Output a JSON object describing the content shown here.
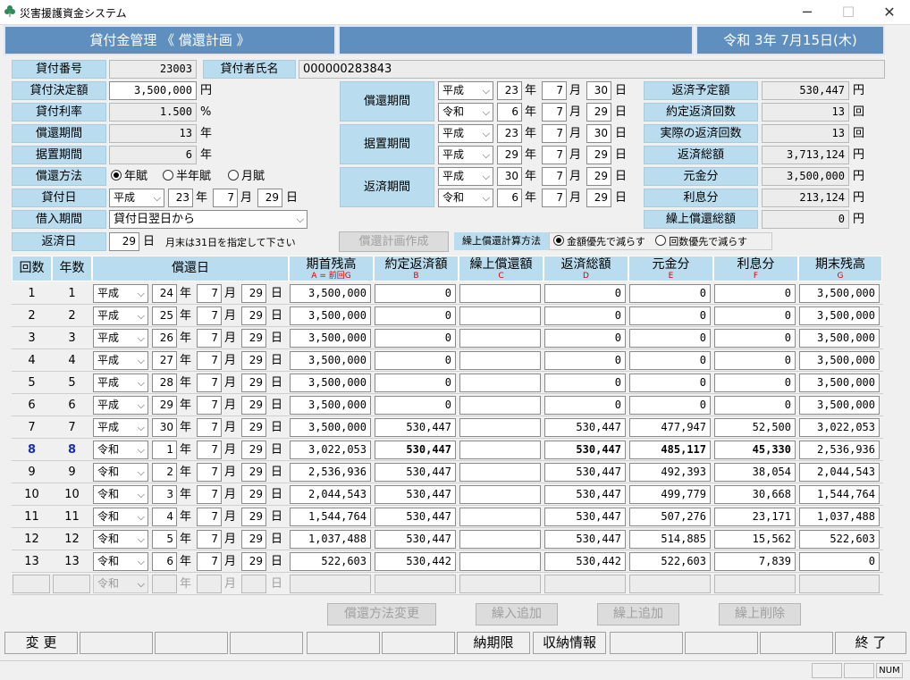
{
  "window": {
    "title": "災害援護資金システム",
    "min": "─",
    "max": "☐",
    "close": "✕"
  },
  "header": {
    "module": "貸付金管理 《 償還計画 》",
    "center": "",
    "date": "令和 3年 7月15日(木)"
  },
  "form": {
    "loan_no_label": "貸付番号",
    "loan_no": "23003",
    "borrower_label": "貸付者氏名",
    "borrower": "000000283843",
    "amount_label": "貸付決定額",
    "amount": "3,500,000",
    "amount_unit": "円",
    "rate_label": "貸付利率",
    "rate": "1.500",
    "rate_unit": "%",
    "period_label": "償還期間",
    "period": "13",
    "period_unit": "年",
    "grace_label": "据置期間",
    "grace": "6",
    "grace_unit": "年",
    "method_label": "償還方法",
    "method_opts": [
      "年賦",
      "半年賦",
      "月賦"
    ],
    "loan_date_label": "貸付日",
    "loan_date": {
      "era": "平成",
      "y": "23",
      "y_u": "年",
      "m": "7",
      "m_u": "月",
      "d": "29",
      "d_u": "日"
    },
    "borrow_period_label": "借入期間",
    "borrow_period": "貸付日翌日から",
    "repay_day_label": "返済日",
    "repay_day": "29",
    "repay_day_unit": "日",
    "repay_note": "月末は31日を指定して下さい"
  },
  "periods": [
    {
      "label": "償還期間",
      "rows": [
        {
          "era": "平成",
          "y": "23",
          "m": "7",
          "d": "30"
        },
        {
          "era": "令和",
          "y": "6",
          "m": "7",
          "d": "29"
        }
      ]
    },
    {
      "label": "据置期間",
      "rows": [
        {
          "era": "平成",
          "y": "23",
          "m": "7",
          "d": "30"
        },
        {
          "era": "平成",
          "y": "29",
          "m": "7",
          "d": "29"
        }
      ]
    },
    {
      "label": "返済期間",
      "rows": [
        {
          "era": "平成",
          "y": "30",
          "m": "7",
          "d": "29"
        },
        {
          "era": "令和",
          "y": "6",
          "m": "7",
          "d": "29"
        }
      ]
    }
  ],
  "units": {
    "y": "年",
    "m": "月",
    "d": "日",
    "yen": "円",
    "kai": "回"
  },
  "summary": [
    {
      "label": "返済予定額",
      "value": "530,447",
      "unit": "円"
    },
    {
      "label": "約定返済回数",
      "value": "13",
      "unit": "回"
    },
    {
      "label": "実際の返済回数",
      "value": "13",
      "unit": "回"
    },
    {
      "label": "返済総額",
      "value": "3,713,124",
      "unit": "円"
    },
    {
      "label": "元金分",
      "value": "3,500,000",
      "unit": "円"
    },
    {
      "label": "利息分",
      "value": "213,124",
      "unit": "円"
    },
    {
      "label": "繰上償還総額",
      "value": "0",
      "unit": "円"
    }
  ],
  "plan_button": "償還計画作成",
  "prepay_label": "繰上償還計算方法",
  "prepay_opts": [
    "金額優先で減らす",
    "回数優先で減らす"
  ],
  "table": {
    "headers": [
      {
        "t": "回数",
        "s": ""
      },
      {
        "t": "年数",
        "s": ""
      },
      {
        "t": "償還日",
        "s": ""
      },
      {
        "t": "期首残高",
        "s": "A = 前回G"
      },
      {
        "t": "約定返済額",
        "s": "B"
      },
      {
        "t": "繰上償還額",
        "s": "C"
      },
      {
        "t": "返済総額",
        "s": "D"
      },
      {
        "t": "元金分",
        "s": "E"
      },
      {
        "t": "利息分",
        "s": "F"
      },
      {
        "t": "期末残高",
        "s": "G"
      }
    ],
    "rows": [
      {
        "n": "1",
        "yr": "1",
        "era": "平成",
        "y": "24",
        "m": "7",
        "d": "29",
        "a": "3,500,000",
        "b": "0",
        "c": "",
        "dd": "0",
        "e": "0",
        "f": "0",
        "g": "3,500,000"
      },
      {
        "n": "2",
        "yr": "2",
        "era": "平成",
        "y": "25",
        "m": "7",
        "d": "29",
        "a": "3,500,000",
        "b": "0",
        "c": "",
        "dd": "0",
        "e": "0",
        "f": "0",
        "g": "3,500,000"
      },
      {
        "n": "3",
        "yr": "3",
        "era": "平成",
        "y": "26",
        "m": "7",
        "d": "29",
        "a": "3,500,000",
        "b": "0",
        "c": "",
        "dd": "0",
        "e": "0",
        "f": "0",
        "g": "3,500,000"
      },
      {
        "n": "4",
        "yr": "4",
        "era": "平成",
        "y": "27",
        "m": "7",
        "d": "29",
        "a": "3,500,000",
        "b": "0",
        "c": "",
        "dd": "0",
        "e": "0",
        "f": "0",
        "g": "3,500,000"
      },
      {
        "n": "5",
        "yr": "5",
        "era": "平成",
        "y": "28",
        "m": "7",
        "d": "29",
        "a": "3,500,000",
        "b": "0",
        "c": "",
        "dd": "0",
        "e": "0",
        "f": "0",
        "g": "3,500,000"
      },
      {
        "n": "6",
        "yr": "6",
        "era": "平成",
        "y": "29",
        "m": "7",
        "d": "29",
        "a": "3,500,000",
        "b": "0",
        "c": "",
        "dd": "0",
        "e": "0",
        "f": "0",
        "g": "3,500,000"
      },
      {
        "n": "7",
        "yr": "7",
        "era": "平成",
        "y": "30",
        "m": "7",
        "d": "29",
        "a": "3,500,000",
        "b": "530,447",
        "c": "",
        "dd": "530,447",
        "e": "477,947",
        "f": "52,500",
        "g": "3,022,053"
      },
      {
        "n": "8",
        "yr": "8",
        "era": "令和",
        "y": "1",
        "m": "7",
        "d": "29",
        "a": "3,022,053",
        "b": "530,447",
        "c": "",
        "dd": "530,447",
        "e": "485,117",
        "f": "45,330",
        "g": "2,536,936",
        "hl": true
      },
      {
        "n": "9",
        "yr": "9",
        "era": "令和",
        "y": "2",
        "m": "7",
        "d": "29",
        "a": "2,536,936",
        "b": "530,447",
        "c": "",
        "dd": "530,447",
        "e": "492,393",
        "f": "38,054",
        "g": "2,044,543"
      },
      {
        "n": "10",
        "yr": "10",
        "era": "令和",
        "y": "3",
        "m": "7",
        "d": "29",
        "a": "2,044,543",
        "b": "530,447",
        "c": "",
        "dd": "530,447",
        "e": "499,779",
        "f": "30,668",
        "g": "1,544,764"
      },
      {
        "n": "11",
        "yr": "11",
        "era": "令和",
        "y": "4",
        "m": "7",
        "d": "29",
        "a": "1,544,764",
        "b": "530,447",
        "c": "",
        "dd": "530,447",
        "e": "507,276",
        "f": "23,171",
        "g": "1,037,488"
      },
      {
        "n": "12",
        "yr": "12",
        "era": "令和",
        "y": "5",
        "m": "7",
        "d": "29",
        "a": "1,037,488",
        "b": "530,447",
        "c": "",
        "dd": "530,447",
        "e": "514,885",
        "f": "15,562",
        "g": "522,603"
      },
      {
        "n": "13",
        "yr": "13",
        "era": "令和",
        "y": "6",
        "m": "7",
        "d": "29",
        "a": "522,603",
        "b": "530,442",
        "c": "",
        "dd": "530,442",
        "e": "522,603",
        "f": "7,839",
        "g": "0"
      }
    ],
    "empty_era": "令和"
  },
  "action_buttons": [
    "償還方法変更",
    "繰入追加",
    "繰上追加",
    "繰上削除"
  ],
  "fkeys": [
    "変 更",
    "",
    "",
    "",
    "",
    "",
    "納期限",
    "収納情報",
    "",
    "",
    "",
    "終 了"
  ],
  "status": {
    "num": "NUM"
  }
}
